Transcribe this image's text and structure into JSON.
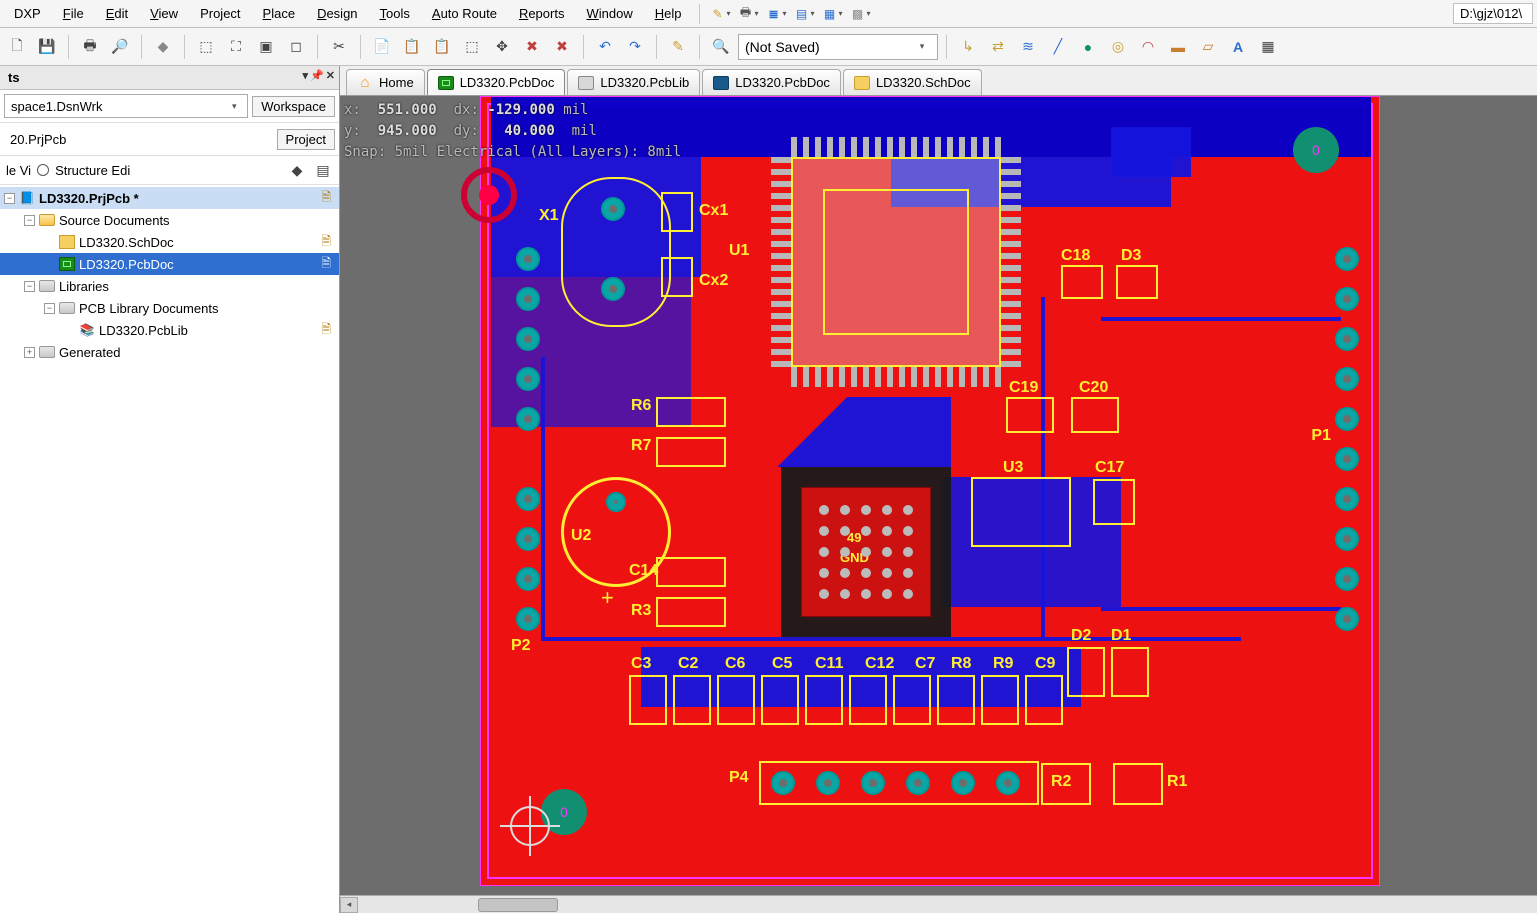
{
  "menu": {
    "items": [
      "DXP",
      "File",
      "Edit",
      "View",
      "Project",
      "Place",
      "Design",
      "Tools",
      "Auto Route",
      "Reports",
      "Window",
      "Help"
    ],
    "accel": [
      0,
      0,
      0,
      0,
      0,
      0,
      0,
      0,
      0,
      0,
      0,
      0
    ]
  },
  "path_display": "D:\\gjz\\012\\",
  "save_combo": "(Not Saved)",
  "sidebar": {
    "title": "ts",
    "workspace": "space1.DsnWrk",
    "workspace_btn": "Workspace",
    "project_value": "20.PrjPcb",
    "project_btn": "Project",
    "view_radio_a": "le Vi",
    "view_radio_b": "Structure Edi"
  },
  "tree": {
    "root": "LD3320.PrjPcb *",
    "source_docs": "Source Documents",
    "sch": "LD3320.SchDoc",
    "pcb": "LD3320.PcbDoc",
    "libs": "Libraries",
    "pcblib_folder": "PCB Library Documents",
    "pcblib": "LD3320.PcbLib",
    "generated": "Generated"
  },
  "tabs": {
    "home": "Home",
    "pcbdoc": "LD3320.PcbDoc",
    "pcblib": "LD3320.PcbLib",
    "pcbdoc2": "LD3320.PcbDoc",
    "schdoc": "LD3320.SchDoc"
  },
  "hud": {
    "x_label": "x:",
    "x_val": "551.000",
    "dx_label": "dx:",
    "dx_val": "-129.000",
    "y_label": "y:",
    "y_val": "945.000",
    "dy_label": "dy:",
    "dy_val": "40.000",
    "unit": "mil",
    "snap": "Snap: 5mil Electrical (All Layers): 8mil"
  },
  "designators": {
    "X1": "X1",
    "Cx1": "Cx1",
    "Cx2": "Cx2",
    "U1": "U1",
    "U2": "U2",
    "U3": "U3",
    "R6": "R6",
    "R7": "R7",
    "R3": "R3",
    "C14": "C14",
    "C18": "C18",
    "D3": "D3",
    "C19": "C19",
    "C20": "C20",
    "C17": "C17",
    "P1": "P1",
    "P2": "P2",
    "P4": "P4",
    "C3": "C3",
    "C2": "C2",
    "C6": "C6",
    "C5": "C5",
    "C11": "C11",
    "C12": "C12",
    "C7": "C7",
    "R8": "R8",
    "R9": "R9",
    "C9": "C9",
    "D2": "D2",
    "D1": "D1",
    "R2": "R2",
    "R1": "R1",
    "ic49": "49",
    "gnd": "GND",
    "tp0a": "0",
    "tp0b": "0"
  }
}
